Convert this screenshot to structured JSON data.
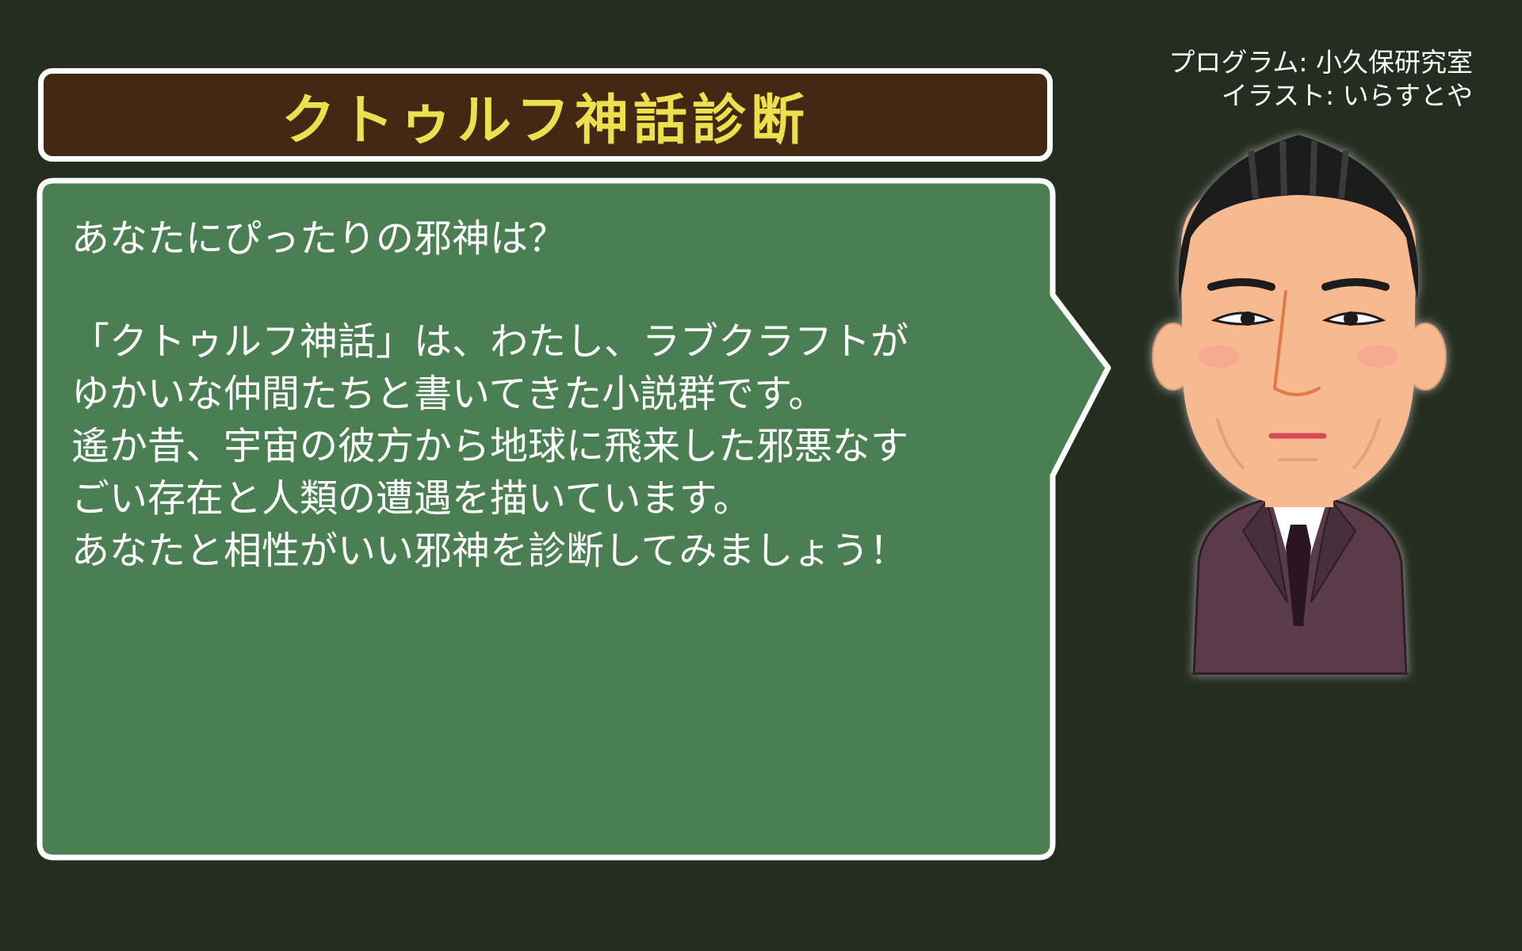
{
  "title": "クトゥルフ神話診断",
  "credits": {
    "program": "プログラム: 小久保研究室",
    "illust": "イラスト: いらすとや"
  },
  "dialog": {
    "question": "あなたにぴったりの邪神は？",
    "lines": [
      "「クトゥルフ神話」は、わたし、ラブクラフトが",
      "ゆかいな仲間たちと書いてきた小説群です。",
      "遙か昔、宇宙の彼方から地球に飛来した邪悪なす",
      "ごい存在と人類の遭遇を描いています。",
      "あなたと相性がいい邪神を診断してみましょう！"
    ]
  },
  "colors": {
    "background": "#252c20",
    "title_bg": "#432914",
    "title_text": "#ede04e",
    "dialog_bg": "#4b7e52",
    "border": "#ffffff"
  },
  "character": {
    "icon": "lovecraft-portrait"
  }
}
